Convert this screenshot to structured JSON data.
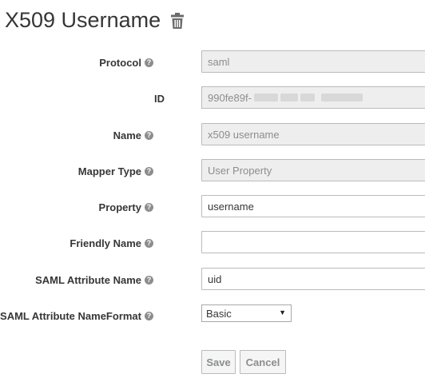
{
  "page": {
    "title": "X509 Username"
  },
  "form": {
    "protocol": {
      "label": "Protocol",
      "value": "saml"
    },
    "id": {
      "label": "ID",
      "value_prefix": "990fe89f-"
    },
    "name": {
      "label": "Name",
      "value": "x509 username"
    },
    "mapper_type": {
      "label": "Mapper Type",
      "value": "User Property"
    },
    "property": {
      "label": "Property",
      "value": "username"
    },
    "friendly_name": {
      "label": "Friendly Name",
      "value": ""
    },
    "saml_attribute_name": {
      "label": "SAML Attribute Name",
      "value": "uid"
    },
    "saml_attribute_nameformat": {
      "label": "SAML Attribute NameFormat",
      "selected": "Basic",
      "arrow": "▼"
    }
  },
  "help_glyph": "?",
  "buttons": {
    "save": "Save",
    "cancel": "Cancel"
  },
  "icons": {
    "title_action": "trash-icon",
    "help": "question-circle-icon"
  }
}
